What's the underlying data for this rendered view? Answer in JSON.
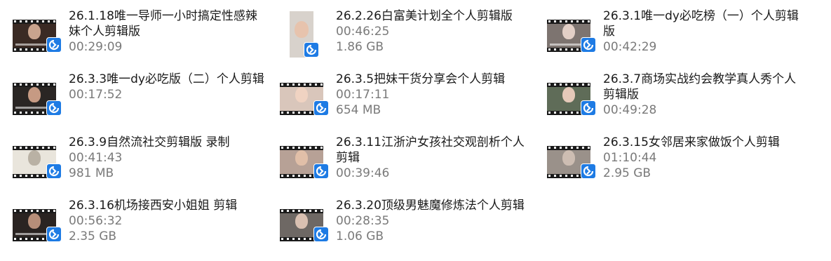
{
  "items": [
    {
      "title": "26.1.18唯一导师一小时搞定性感辣妹个人剪辑版",
      "duration": "00:29:09",
      "size": "",
      "thumb_bg": "#3a2a24",
      "thumb_face": "#c9a48e",
      "portrait": false,
      "badge_icon": "sync-icon"
    },
    {
      "title": "26.2.26白富美计划全个人剪辑版",
      "duration": "00:46:25",
      "size": "1.86 GB",
      "thumb_bg": "#d8d2cc",
      "thumb_face": "#e7c3ad",
      "portrait": true,
      "badge_icon": "sync-icon"
    },
    {
      "title": "26.3.1唯一dy必吃榜（一）个人剪辑版",
      "duration": "00:42:29",
      "size": "",
      "thumb_bg": "#7d7470",
      "thumb_face": "#e2cfc6",
      "portrait": false,
      "badge_icon": "sync-icon"
    },
    {
      "title": "26.3.3唯一dy必吃版（二）个人剪辑",
      "duration": "00:17:52",
      "size": "",
      "thumb_bg": "#2a2624",
      "thumb_face": "#c69a83",
      "portrait": false,
      "badge_icon": "sync-icon"
    },
    {
      "title": "26.3.5把妹干货分享会个人剪辑",
      "duration": "00:17:11",
      "size": "654 MB",
      "thumb_bg": "#d9c6bb",
      "thumb_face": "#f0d3c2",
      "portrait": false,
      "badge_icon": "sync-icon"
    },
    {
      "title": "26.3.7商场实战约会教学真人秀个人剪辑版",
      "duration": "00:49:28",
      "size": "",
      "thumb_bg": "#5f6c58",
      "thumb_face": "#e5c9b9",
      "portrait": false,
      "badge_icon": "sync-icon"
    },
    {
      "title": "26.3.9自然流社交剪辑版 录制",
      "duration": "00:41:43",
      "size": "981 MB",
      "thumb_bg": "#e9e5dc",
      "thumb_face": "#b9b1a4",
      "portrait": false,
      "badge_icon": "sync-icon"
    },
    {
      "title": "26.3.11江浙沪女孩社交观剖析个人剪辑",
      "duration": "00:39:46",
      "size": "",
      "thumb_bg": "#b7a196",
      "thumb_face": "#e1bfa8",
      "portrait": false,
      "badge_icon": "sync-icon"
    },
    {
      "title": "26.3.15女邻居来家做饭个人剪辑",
      "duration": "01:10:44",
      "size": "2.95 GB",
      "thumb_bg": "#9a918a",
      "thumb_face": "#cdbdb2",
      "portrait": false,
      "badge_icon": "sync-icon"
    },
    {
      "title": "26.3.16机场接西安小姐姐 剪辑",
      "duration": "00:56:32",
      "size": "2.35 GB",
      "thumb_bg": "#2a2422",
      "thumb_face": "#b68e79",
      "portrait": false,
      "badge_icon": "sync-icon"
    },
    {
      "title": "26.3.20顶级男魅魔修炼法个人剪辑",
      "duration": "00:28:35",
      "size": "1.06 GB",
      "thumb_bg": "#6e6864",
      "thumb_face": "#d9c0b1",
      "portrait": false,
      "badge_icon": "sync-icon"
    }
  ],
  "colors": {
    "title_text": "#1a1a1a",
    "meta_text": "#7a7a7a",
    "badge": "#1e7be4"
  }
}
